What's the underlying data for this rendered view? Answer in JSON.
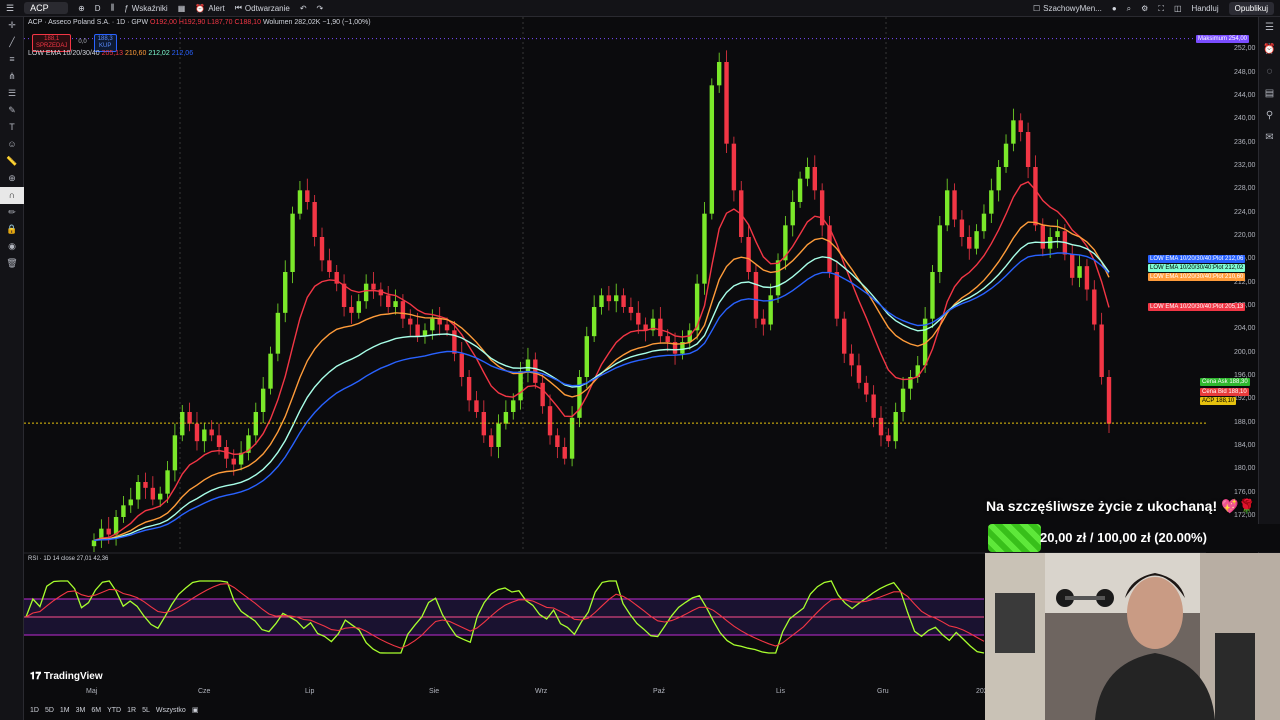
{
  "toolbar": {
    "symbol": "ACP",
    "interval": "D",
    "indicators_label": "Wskaźniki",
    "alert_label": "Alert",
    "replay_label": "Odtwarzanie",
    "layout_name": "SzachowyMen...",
    "trade_label": "Handluj",
    "publish_label": "Opublikuj"
  },
  "legend": {
    "title": "ACP · Asseco Poland S.A. · 1D · GPW",
    "ohlc": "O192,00 H192,90 L187,70 C188,10",
    "volume": "Wolumen 282,02K −1,90 (−1,00%)",
    "sell_price": "188,1",
    "sell_label": "SPRZEDAJ",
    "spread": "0,0",
    "buy_price": "188,3",
    "buy_label": "KUP",
    "ema_line": "LOW EMA 10/20/30/40",
    "ema_values": [
      "205,13",
      "210,60",
      "212,02",
      "212,06"
    ]
  },
  "rsi_legend": "RSI · 1D 14 close 27,01 42,36",
  "y_axis": {
    "ticks": [
      "252,00",
      "248,00",
      "244,00",
      "240,00",
      "236,00",
      "232,00",
      "228,00",
      "224,00",
      "220,00",
      "216,00",
      "212,00",
      "208,00",
      "204,00",
      "200,00",
      "196,00",
      "192,00",
      "188,00",
      "184,00",
      "180,00",
      "176,00",
      "172,00",
      "168,00"
    ],
    "max_label": "Maksimum",
    "max_value": "254,00"
  },
  "price_labels": [
    {
      "text": "LOW EMA 10/20/30/40:Plot",
      "value": "212,06",
      "color": "#2962ff"
    },
    {
      "text": "LOW EMA 10/20/30/40:Plot",
      "value": "212,02",
      "color": "#7fffd4"
    },
    {
      "text": "LOW EMA 10/20/30/40:Plot",
      "value": "210,60",
      "color": "#ff9c3a"
    },
    {
      "text": "LOW EMA 10/20/30/40:Plot",
      "value": "205,13",
      "color": "#f23645"
    },
    {
      "text": "Cena Ask",
      "value": "188,30",
      "color": "#2eb82e"
    },
    {
      "text": "Cena Bid",
      "value": "188,10",
      "color": "#e83b3b"
    },
    {
      "text": "ACP",
      "value": "188,10",
      "color": "#e6c20e"
    }
  ],
  "x_axis": [
    "Maj",
    "Cze",
    "Lip",
    "Sie",
    "Wrz",
    "Paź",
    "Lis",
    "Gru",
    "202"
  ],
  "watermark": "TradingView",
  "timeframes": [
    "1D",
    "5D",
    "1M",
    "3M",
    "6M",
    "YTD",
    "1R",
    "5L",
    "Wszystko"
  ],
  "donation": {
    "title": "Na szczęśliwsze życie z ukochaną! 💖🌹",
    "progress_text": "20,00 zł / 100,00 zł (20.00%)",
    "progress": 0.2
  },
  "chart_data": {
    "type": "candlestick",
    "symbol": "ACP",
    "ylim": [
      166,
      256
    ],
    "close_series": [
      168,
      170,
      169,
      172,
      174,
      175,
      178,
      177,
      175,
      176,
      180,
      186,
      190,
      188,
      185,
      187,
      186,
      184,
      182,
      181,
      183,
      186,
      190,
      194,
      200,
      207,
      214,
      224,
      228,
      226,
      220,
      216,
      214,
      212,
      208,
      207,
      209,
      212,
      211,
      210,
      208,
      209,
      206,
      205,
      203,
      204,
      206,
      205,
      204,
      200,
      196,
      192,
      190,
      186,
      184,
      188,
      190,
      192,
      197,
      199,
      195,
      191,
      186,
      184,
      182,
      189,
      196,
      203,
      208,
      210,
      209,
      210,
      208,
      207,
      205,
      204,
      206,
      203,
      202,
      200,
      202,
      204,
      212,
      224,
      246,
      250,
      236,
      228,
      220,
      214,
      206,
      205,
      210,
      216,
      222,
      226,
      230,
      232,
      228,
      222,
      214,
      206,
      200,
      198,
      195,
      193,
      189,
      186,
      185,
      190,
      194,
      196,
      198,
      206,
      214,
      222,
      228,
      223,
      220,
      218,
      221,
      224,
      228,
      232,
      236,
      240,
      238,
      232,
      222,
      218,
      220,
      221,
      217,
      213,
      215,
      211,
      205,
      196,
      188
    ]
  }
}
